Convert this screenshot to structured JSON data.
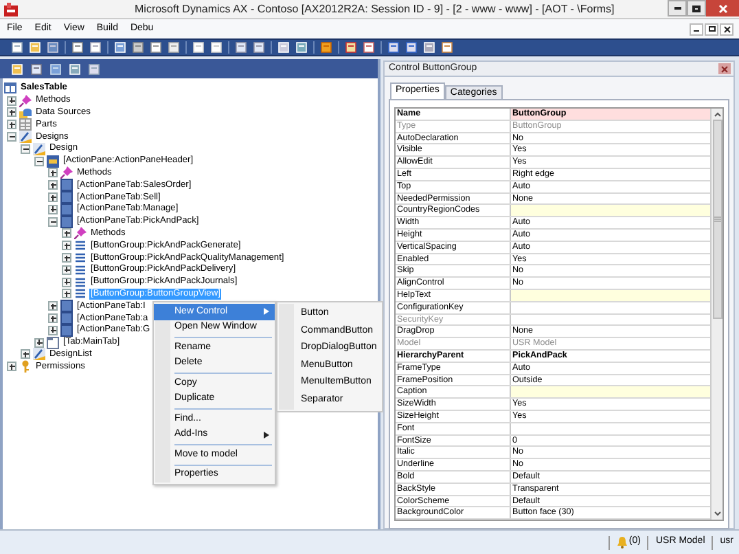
{
  "window": {
    "title": "Microsoft Dynamics AX - Contoso [AX2012R2A: Session ID - 9] - [2 - www - www] - [AOT - \\Forms]"
  },
  "menu_bar": [
    "File",
    "Edit",
    "View",
    "Build",
    "Debu"
  ],
  "aot_tree": {
    "root": {
      "label": "SalesTable",
      "kind": "table",
      "selected": false,
      "children": [
        {
          "label": "Methods",
          "kind": "methods",
          "expanded": false,
          "selected": false
        },
        {
          "label": "Data Sources",
          "kind": "datasources",
          "expanded": false,
          "selected": false
        },
        {
          "label": "Parts",
          "kind": "parts",
          "expanded": false,
          "selected": false
        },
        {
          "label": "Designs",
          "kind": "designs",
          "expanded": true,
          "selected": false,
          "children": [
            {
              "label": "Design",
              "kind": "designs",
              "expanded": true,
              "selected": false,
              "children": [
                {
                  "label": "[ActionPane:ActionPaneHeader]",
                  "kind": "actionpane",
                  "expanded": true,
                  "selected": false,
                  "children": [
                    {
                      "label": "Methods",
                      "kind": "methods",
                      "expanded": false,
                      "selected": false
                    },
                    {
                      "label": "[ActionPaneTab:SalesOrder]",
                      "kind": "tab",
                      "expanded": false,
                      "selected": false
                    },
                    {
                      "label": "[ActionPaneTab:Sell]",
                      "kind": "tab",
                      "expanded": false,
                      "selected": false
                    },
                    {
                      "label": "[ActionPaneTab:Manage]",
                      "kind": "tab",
                      "expanded": false,
                      "selected": false
                    },
                    {
                      "label": "[ActionPaneTab:PickAndPack]",
                      "kind": "tab",
                      "expanded": true,
                      "selected": false,
                      "children": [
                        {
                          "label": "Methods",
                          "kind": "methods",
                          "expanded": false,
                          "selected": false
                        },
                        {
                          "label": "[ButtonGroup:PickAndPackGenerate]",
                          "kind": "buttongroup",
                          "expanded": false,
                          "selected": false
                        },
                        {
                          "label": "[ButtonGroup:PickAndPackQualityManagement]",
                          "kind": "buttongroup",
                          "expanded": false,
                          "selected": false
                        },
                        {
                          "label": "[ButtonGroup:PickAndPackDelivery]",
                          "kind": "buttongroup",
                          "expanded": false,
                          "selected": false
                        },
                        {
                          "label": "[ButtonGroup:PickAndPackJournals]",
                          "kind": "buttongroup",
                          "expanded": false,
                          "selected": false
                        },
                        {
                          "label": "[ButtonGroup:ButtonGroupView]",
                          "kind": "buttongroup",
                          "expanded": false,
                          "selected": true
                        }
                      ]
                    },
                    {
                      "label": "[ActionPaneTab:I",
                      "kind": "tab",
                      "expanded": false,
                      "selected": false
                    },
                    {
                      "label": "[ActionPaneTab:a",
                      "kind": "tab",
                      "expanded": false,
                      "selected": false
                    },
                    {
                      "label": "[ActionPaneTab:G",
                      "kind": "tab",
                      "expanded": false,
                      "selected": false
                    }
                  ]
                },
                {
                  "label": "[Tab:MainTab]",
                  "kind": "tabpage",
                  "expanded": false,
                  "selected": false
                }
              ]
            },
            {
              "label": "DesignList",
              "kind": "designs",
              "expanded": false,
              "selected": false
            }
          ]
        },
        {
          "label": "Permissions",
          "kind": "permissions",
          "expanded": false,
          "selected": false
        }
      ]
    }
  },
  "context_menu": {
    "items": [
      {
        "kind": "item",
        "label": "New Control",
        "selected": true,
        "submenu": true
      },
      {
        "kind": "item",
        "label": "Open New Window",
        "selected": false,
        "submenu": false
      },
      {
        "kind": "separator"
      },
      {
        "kind": "item",
        "label": "Rename",
        "selected": false,
        "submenu": false
      },
      {
        "kind": "item",
        "label": "Delete",
        "selected": false,
        "submenu": false
      },
      {
        "kind": "separator"
      },
      {
        "kind": "item",
        "label": "Copy",
        "selected": false,
        "submenu": false
      },
      {
        "kind": "item",
        "label": "Duplicate",
        "selected": false,
        "submenu": false
      },
      {
        "kind": "separator"
      },
      {
        "kind": "item",
        "label": "Find...",
        "selected": false,
        "submenu": false
      },
      {
        "kind": "item",
        "label": "Add-Ins",
        "selected": false,
        "submenu": true
      },
      {
        "kind": "separator"
      },
      {
        "kind": "item",
        "label": "Move to model",
        "selected": false,
        "submenu": false
      },
      {
        "kind": "separator"
      },
      {
        "kind": "item",
        "label": "Properties",
        "selected": false,
        "submenu": false
      }
    ]
  },
  "submenu": {
    "items": [
      "Button",
      "CommandButton",
      "DropDialogButton",
      "MenuButton",
      "MenuItemButton",
      "Separator"
    ]
  },
  "properties_panel": {
    "title": "Control ButtonGroup",
    "tabs": [
      {
        "label": "Properties",
        "selected": true
      },
      {
        "label": "Categories",
        "selected": false
      }
    ],
    "rows": [
      {
        "name": "Name",
        "value": "ButtonGroup",
        "kind": "header"
      },
      {
        "name": "Type",
        "value": "ButtonGroup",
        "kind": "disabled"
      },
      {
        "name": "AutoDeclaration",
        "value": "No",
        "kind": "plain"
      },
      {
        "name": "Visible",
        "value": "Yes",
        "kind": "plain"
      },
      {
        "name": "AllowEdit",
        "value": "Yes",
        "kind": "plain"
      },
      {
        "name": "Left",
        "value": "Right edge",
        "kind": "plain"
      },
      {
        "name": "Top",
        "value": "Auto",
        "kind": "plain"
      },
      {
        "name": "NeededPermission",
        "value": "None",
        "kind": "plain"
      },
      {
        "name": "CountryRegionCodes",
        "kind": "input"
      },
      {
        "name": "Width",
        "value": "Auto",
        "kind": "plain"
      },
      {
        "name": "Height",
        "value": "Auto",
        "kind": "plain"
      },
      {
        "name": "VerticalSpacing",
        "value": "Auto",
        "kind": "plain"
      },
      {
        "name": "Enabled",
        "value": "Yes",
        "kind": "plain"
      },
      {
        "name": "Skip",
        "value": "No",
        "kind": "plain"
      },
      {
        "name": "AlignControl",
        "value": "No",
        "kind": "plain"
      },
      {
        "name": "HelpText",
        "kind": "input"
      },
      {
        "name": "ConfigurationKey",
        "kind": "plain"
      },
      {
        "name": "SecurityKey",
        "kind": "disabled"
      },
      {
        "name": "DragDrop",
        "value": "None",
        "kind": "plain"
      },
      {
        "name": "Model",
        "value": "USR Model",
        "kind": "disabled"
      },
      {
        "name": "HierarchyParent",
        "value": "PickAndPack",
        "kind": "bold"
      },
      {
        "name": "FrameType",
        "value": "Auto",
        "kind": "plain"
      },
      {
        "name": "FramePosition",
        "value": "Outside",
        "kind": "plain"
      },
      {
        "name": "Caption",
        "kind": "input"
      },
      {
        "name": "SizeWidth",
        "value": "Yes",
        "kind": "plain"
      },
      {
        "name": "SizeHeight",
        "value": "Yes",
        "kind": "plain"
      },
      {
        "name": "Font",
        "kind": "plain"
      },
      {
        "name": "FontSize",
        "value": "0",
        "kind": "plain"
      },
      {
        "name": "Italic",
        "value": "No",
        "kind": "plain"
      },
      {
        "name": "Underline",
        "value": "No",
        "kind": "plain"
      },
      {
        "name": "Bold",
        "value": "Default",
        "kind": "plain"
      },
      {
        "name": "BackStyle",
        "value": "Transparent",
        "kind": "plain"
      },
      {
        "name": "ColorScheme",
        "value": "Default",
        "kind": "plain"
      },
      {
        "name": "BackgroundColor",
        "value": "Button face (30)",
        "kind": "plain"
      }
    ]
  },
  "status_bar": {
    "alerts": "(0)",
    "model": "USR Model",
    "user": "usr"
  }
}
